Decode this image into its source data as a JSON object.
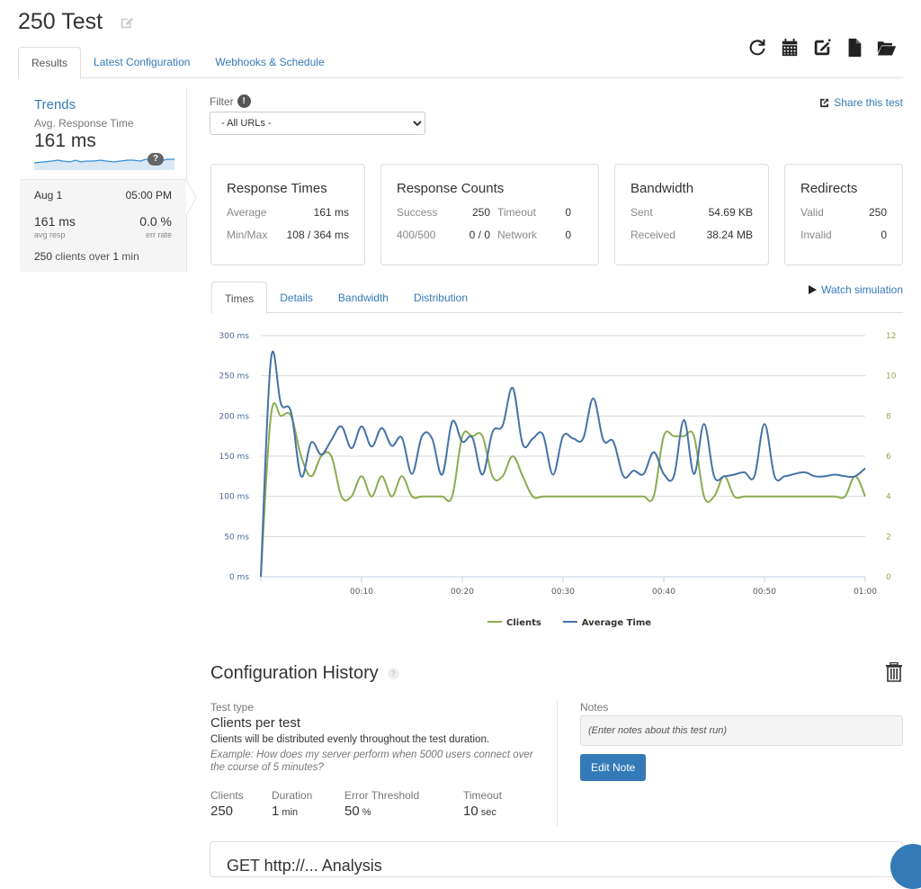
{
  "page": {
    "title": "250 Test",
    "tabs": [
      {
        "label": "Results",
        "active": true
      },
      {
        "label": "Latest Configuration",
        "active": false
      },
      {
        "label": "Webhooks & Schedule",
        "active": false
      }
    ],
    "toolbar_icons": [
      "refresh-icon",
      "calendar-icon",
      "edit-icon",
      "file-icon",
      "folder-open-icon"
    ]
  },
  "sidebar": {
    "trends_label": "Trends",
    "metric_label": "Avg. Response Time",
    "metric_value": "161 ms",
    "help_glyph": "?",
    "run": {
      "date": "Aug 1",
      "time": "05:00 PM",
      "avg_resp": "161 ms",
      "avg_resp_label": "avg resp",
      "err_rate": "0.0 %",
      "err_rate_label": "err rate",
      "clients": "250",
      "clients_mid": " clients over ",
      "duration": "1",
      "duration_unit": " min"
    }
  },
  "filter": {
    "label": "Filter",
    "selected": "- All URLs -"
  },
  "share_label": "Share this test",
  "cards": {
    "response_times": {
      "title": "Response Times",
      "rows": [
        {
          "k": "Average",
          "v": "161 ms"
        },
        {
          "k": "Min/Max",
          "v": "108 / 364 ms"
        }
      ]
    },
    "response_counts": {
      "title": "Response Counts",
      "rows": [
        {
          "k": "Success",
          "v": "250",
          "k2": "Timeout",
          "v2": "0"
        },
        {
          "k": "400/500",
          "v": "0 / 0",
          "k2": "Network",
          "v2": "0"
        }
      ]
    },
    "bandwidth": {
      "title": "Bandwidth",
      "rows": [
        {
          "k": "Sent",
          "v": "54.69 KB"
        },
        {
          "k": "Received",
          "v": "38.24 MB"
        }
      ]
    },
    "redirects": {
      "title": "Redirects",
      "rows": [
        {
          "k": "Valid",
          "v": "250"
        },
        {
          "k": "Invalid",
          "v": "0"
        }
      ]
    }
  },
  "sub_tabs": [
    {
      "label": "Times",
      "active": true
    },
    {
      "label": "Details",
      "active": false
    },
    {
      "label": "Bandwidth",
      "active": false
    },
    {
      "label": "Distribution",
      "active": false
    }
  ],
  "watch_label": "Watch simulation",
  "chart_data": {
    "type": "line",
    "title": "",
    "xlabel": "",
    "ylabel": "",
    "x_unit": "seconds",
    "x_ticks": [
      {
        "v": 10,
        "label": "00:10"
      },
      {
        "v": 20,
        "label": "00:20"
      },
      {
        "v": 30,
        "label": "00:30"
      },
      {
        "v": 40,
        "label": "00:40"
      },
      {
        "v": 50,
        "label": "00:50"
      },
      {
        "v": 60,
        "label": "01:00"
      }
    ],
    "xlim": [
      0,
      60
    ],
    "y_left": {
      "ylim": [
        0,
        300
      ],
      "ticks": [
        0,
        50,
        100,
        150,
        200,
        250,
        300
      ],
      "suffix": " ms"
    },
    "y_right": {
      "ylim": [
        0,
        12
      ],
      "ticks": [
        0,
        2,
        4,
        6,
        8,
        10,
        12
      ]
    },
    "grid": true,
    "legend": "bottom-center",
    "series": [
      {
        "name": "Clients",
        "axis": "right",
        "color": "#8aac50",
        "x": [
          0,
          1,
          2,
          3,
          4,
          5,
          6,
          7,
          8,
          9,
          10,
          11,
          12,
          13,
          14,
          15,
          16,
          17,
          18,
          19,
          20,
          21,
          22,
          23,
          24,
          25,
          26,
          27,
          28,
          29,
          30,
          31,
          32,
          33,
          34,
          35,
          36,
          37,
          38,
          39,
          40,
          41,
          42,
          43,
          44,
          45,
          46,
          47,
          48,
          49,
          50,
          51,
          52,
          53,
          54,
          55,
          56,
          57,
          58,
          59,
          60
        ],
        "values": [
          0,
          8,
          8,
          8,
          6,
          5,
          6,
          6,
          4,
          4,
          5,
          4,
          5,
          4,
          5,
          4,
          4,
          4,
          4,
          4,
          7,
          7,
          7,
          5,
          5,
          6,
          5,
          4,
          4,
          4,
          4,
          4,
          4,
          4,
          4,
          4,
          4,
          4,
          4,
          4,
          7,
          7,
          7,
          7,
          4,
          4,
          5,
          4,
          4,
          4,
          4,
          4,
          4,
          4,
          4,
          4,
          4,
          4,
          4,
          5,
          4
        ]
      },
      {
        "name": "Average Time",
        "axis": "left",
        "color": "#4572a7",
        "x": [
          0,
          1,
          2,
          3,
          4,
          5,
          6,
          7,
          8,
          9,
          10,
          11,
          12,
          13,
          14,
          15,
          16,
          17,
          18,
          19,
          20,
          21,
          22,
          23,
          24,
          25,
          26,
          27,
          28,
          29,
          30,
          31,
          32,
          33,
          34,
          35,
          36,
          37,
          38,
          39,
          40,
          41,
          42,
          43,
          44,
          45,
          46,
          47,
          48,
          49,
          50,
          51,
          52,
          53,
          54,
          55,
          56,
          57,
          58,
          59,
          60
        ],
        "values": [
          0,
          270,
          215,
          205,
          125,
          167,
          152,
          170,
          187,
          160,
          187,
          162,
          185,
          163,
          173,
          128,
          175,
          172,
          127,
          193,
          168,
          173,
          127,
          180,
          188,
          235,
          165,
          172,
          177,
          127,
          175,
          172,
          172,
          222,
          170,
          168,
          125,
          132,
          128,
          155,
          128,
          125,
          195,
          128,
          190,
          125,
          125,
          127,
          130,
          125,
          190,
          125,
          125,
          128,
          130,
          125,
          125,
          127,
          125,
          125,
          135
        ]
      }
    ]
  },
  "config": {
    "title": "Configuration History",
    "help_glyph": "?",
    "test_type_label": "Test type",
    "test_type": "Clients per test",
    "description": "Clients will be distributed evenly throughout the test duration.",
    "example": "Example: How does my server perform when 5000 users connect over the course of 5 minutes?",
    "stats": [
      {
        "label": "Clients",
        "value": "250",
        "unit": ""
      },
      {
        "label": "Duration",
        "value": "1",
        "unit": " min"
      },
      {
        "label": "Error Threshold",
        "value": "50",
        "unit": " %"
      },
      {
        "label": "Timeout",
        "value": "10",
        "unit": " sec"
      }
    ],
    "notes_label": "Notes",
    "notes_placeholder": "(Enter notes about this test run)",
    "edit_note_label": "Edit Note"
  },
  "bottom_card_title": "GET http://... Analysis"
}
